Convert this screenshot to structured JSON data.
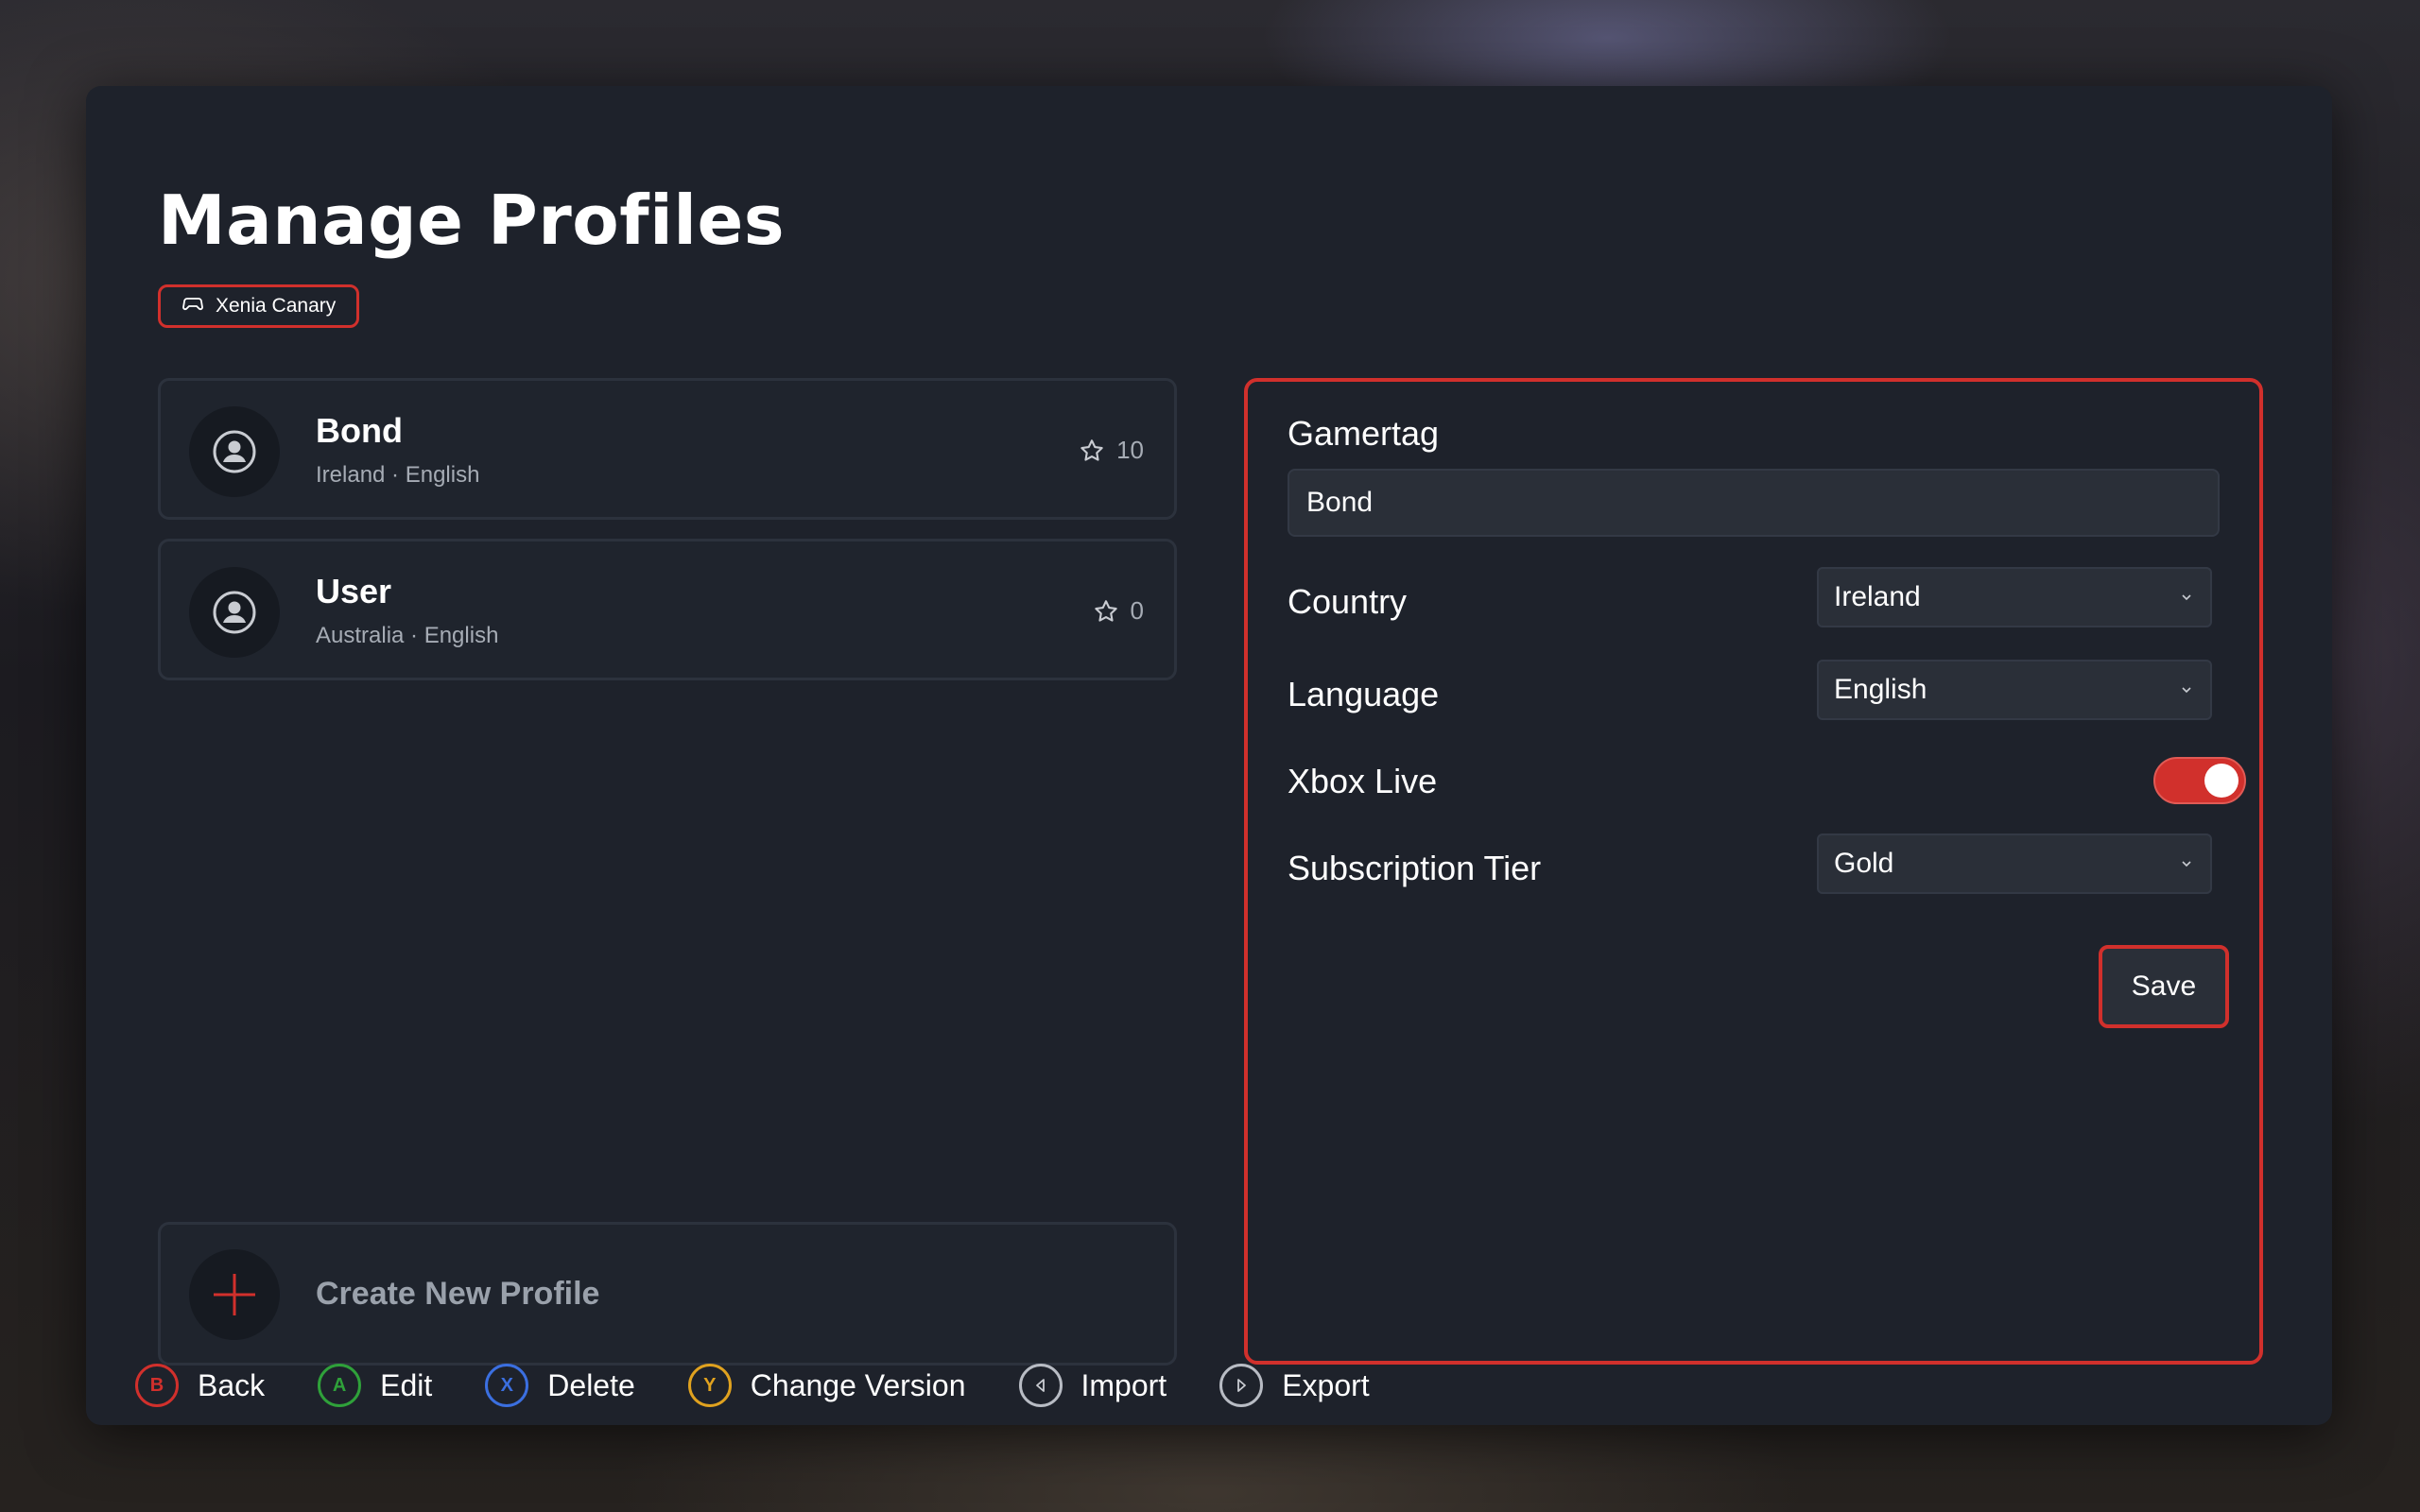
{
  "page": {
    "title": "Manage Profiles"
  },
  "version": {
    "label": "Xenia Canary",
    "icon": "gamepad-icon"
  },
  "profiles": [
    {
      "name": "Bond",
      "subtitle": "Ireland · English",
      "score": "10"
    },
    {
      "name": "User",
      "subtitle": "Australia · English",
      "score": "0"
    }
  ],
  "create": {
    "label": "Create New Profile"
  },
  "editor": {
    "gamertag_label": "Gamertag",
    "gamertag_value": "Bond",
    "country_label": "Country",
    "country_value": "Ireland",
    "language_label": "Language",
    "language_value": "English",
    "xbox_live_label": "Xbox Live",
    "xbox_live_enabled": true,
    "tier_label": "Subscription Tier",
    "tier_value": "Gold",
    "save_label": "Save"
  },
  "hints": [
    {
      "key": "B",
      "label": "Back",
      "color": "#d1302c"
    },
    {
      "key": "A",
      "label": "Edit",
      "color": "#2fa13a"
    },
    {
      "key": "X",
      "label": "Delete",
      "color": "#3b6fe0"
    },
    {
      "key": "Y",
      "label": "Change Version",
      "color": "#e0a21f"
    },
    {
      "key": "",
      "label": "Import",
      "color": "#b8bcc4",
      "icon": "left-trigger-icon"
    },
    {
      "key": "",
      "label": "Export",
      "color": "#b8bcc4",
      "icon": "right-trigger-icon"
    }
  ],
  "colors": {
    "accent": "#d1302c",
    "panel": "#1e222b"
  }
}
